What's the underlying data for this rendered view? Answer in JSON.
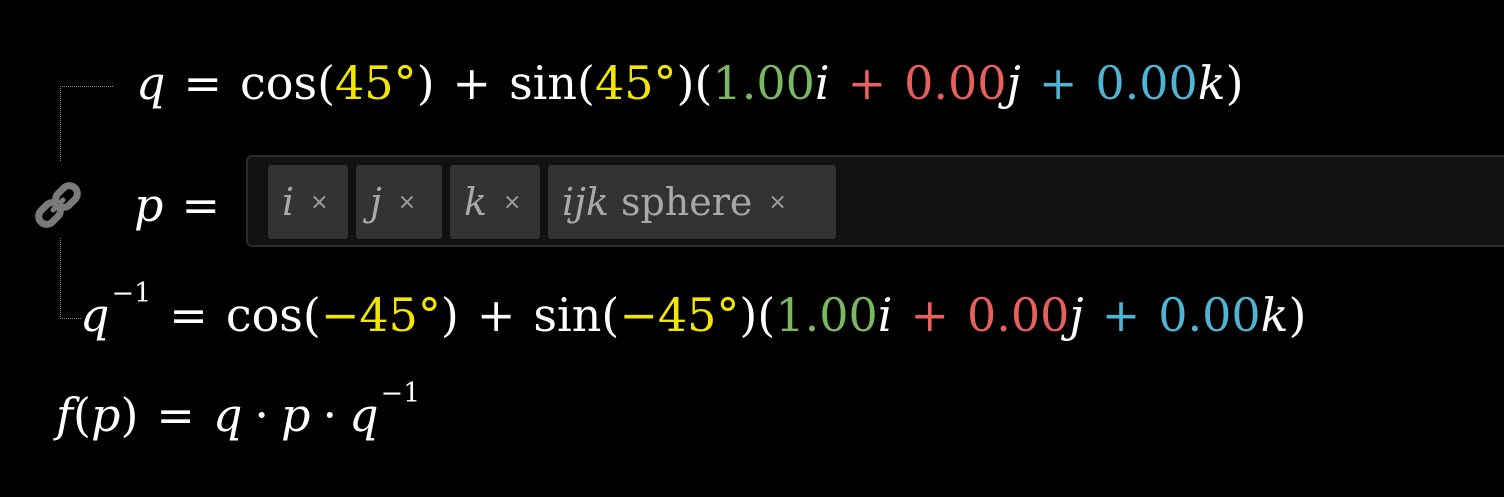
{
  "expressions": {
    "q": {
      "lhs": "q",
      "eq": "=",
      "cos": "cos",
      "angle": "45°",
      "plus": "+",
      "sin": "sin",
      "lparen": "(",
      "rparen": ")",
      "ci": "1.00",
      "i": "i",
      "cj": "0.00",
      "j": "j",
      "ck": "0.00",
      "k": "k"
    },
    "p": {
      "lhs": "p",
      "eq": "="
    },
    "q_inverse": {
      "lhs": "q",
      "exponent": "−1",
      "eq": "=",
      "cos": "cos",
      "angle": "−45°",
      "plus": "+",
      "sin": "sin",
      "lparen": "(",
      "rparen": ")",
      "ci": "1.00",
      "i": "i",
      "cj": "0.00",
      "j": "j",
      "ck": "0.00",
      "k": "k"
    },
    "f": {
      "f": "f",
      "lparen": "(",
      "p": "p",
      "rparen": ")",
      "eq": "=",
      "q": "q",
      "dot": "·",
      "p2": "p",
      "q2": "q",
      "exponent": "−1"
    }
  },
  "tags": [
    {
      "math": "i",
      "text": "",
      "remove": "×"
    },
    {
      "math": "j",
      "text": "",
      "remove": "×"
    },
    {
      "math": "k",
      "text": "",
      "remove": "×"
    },
    {
      "math": "ijk",
      "text": "sphere",
      "remove": "×"
    }
  ],
  "icons": {
    "link": "link-icon"
  },
  "colors": {
    "background": "#000000",
    "angle": "#f2e600",
    "i_component": "#7bb661",
    "j_component": "#e8605a",
    "k_component": "#4fb4d3",
    "tag_background": "#333333",
    "input_background": "#111111"
  }
}
